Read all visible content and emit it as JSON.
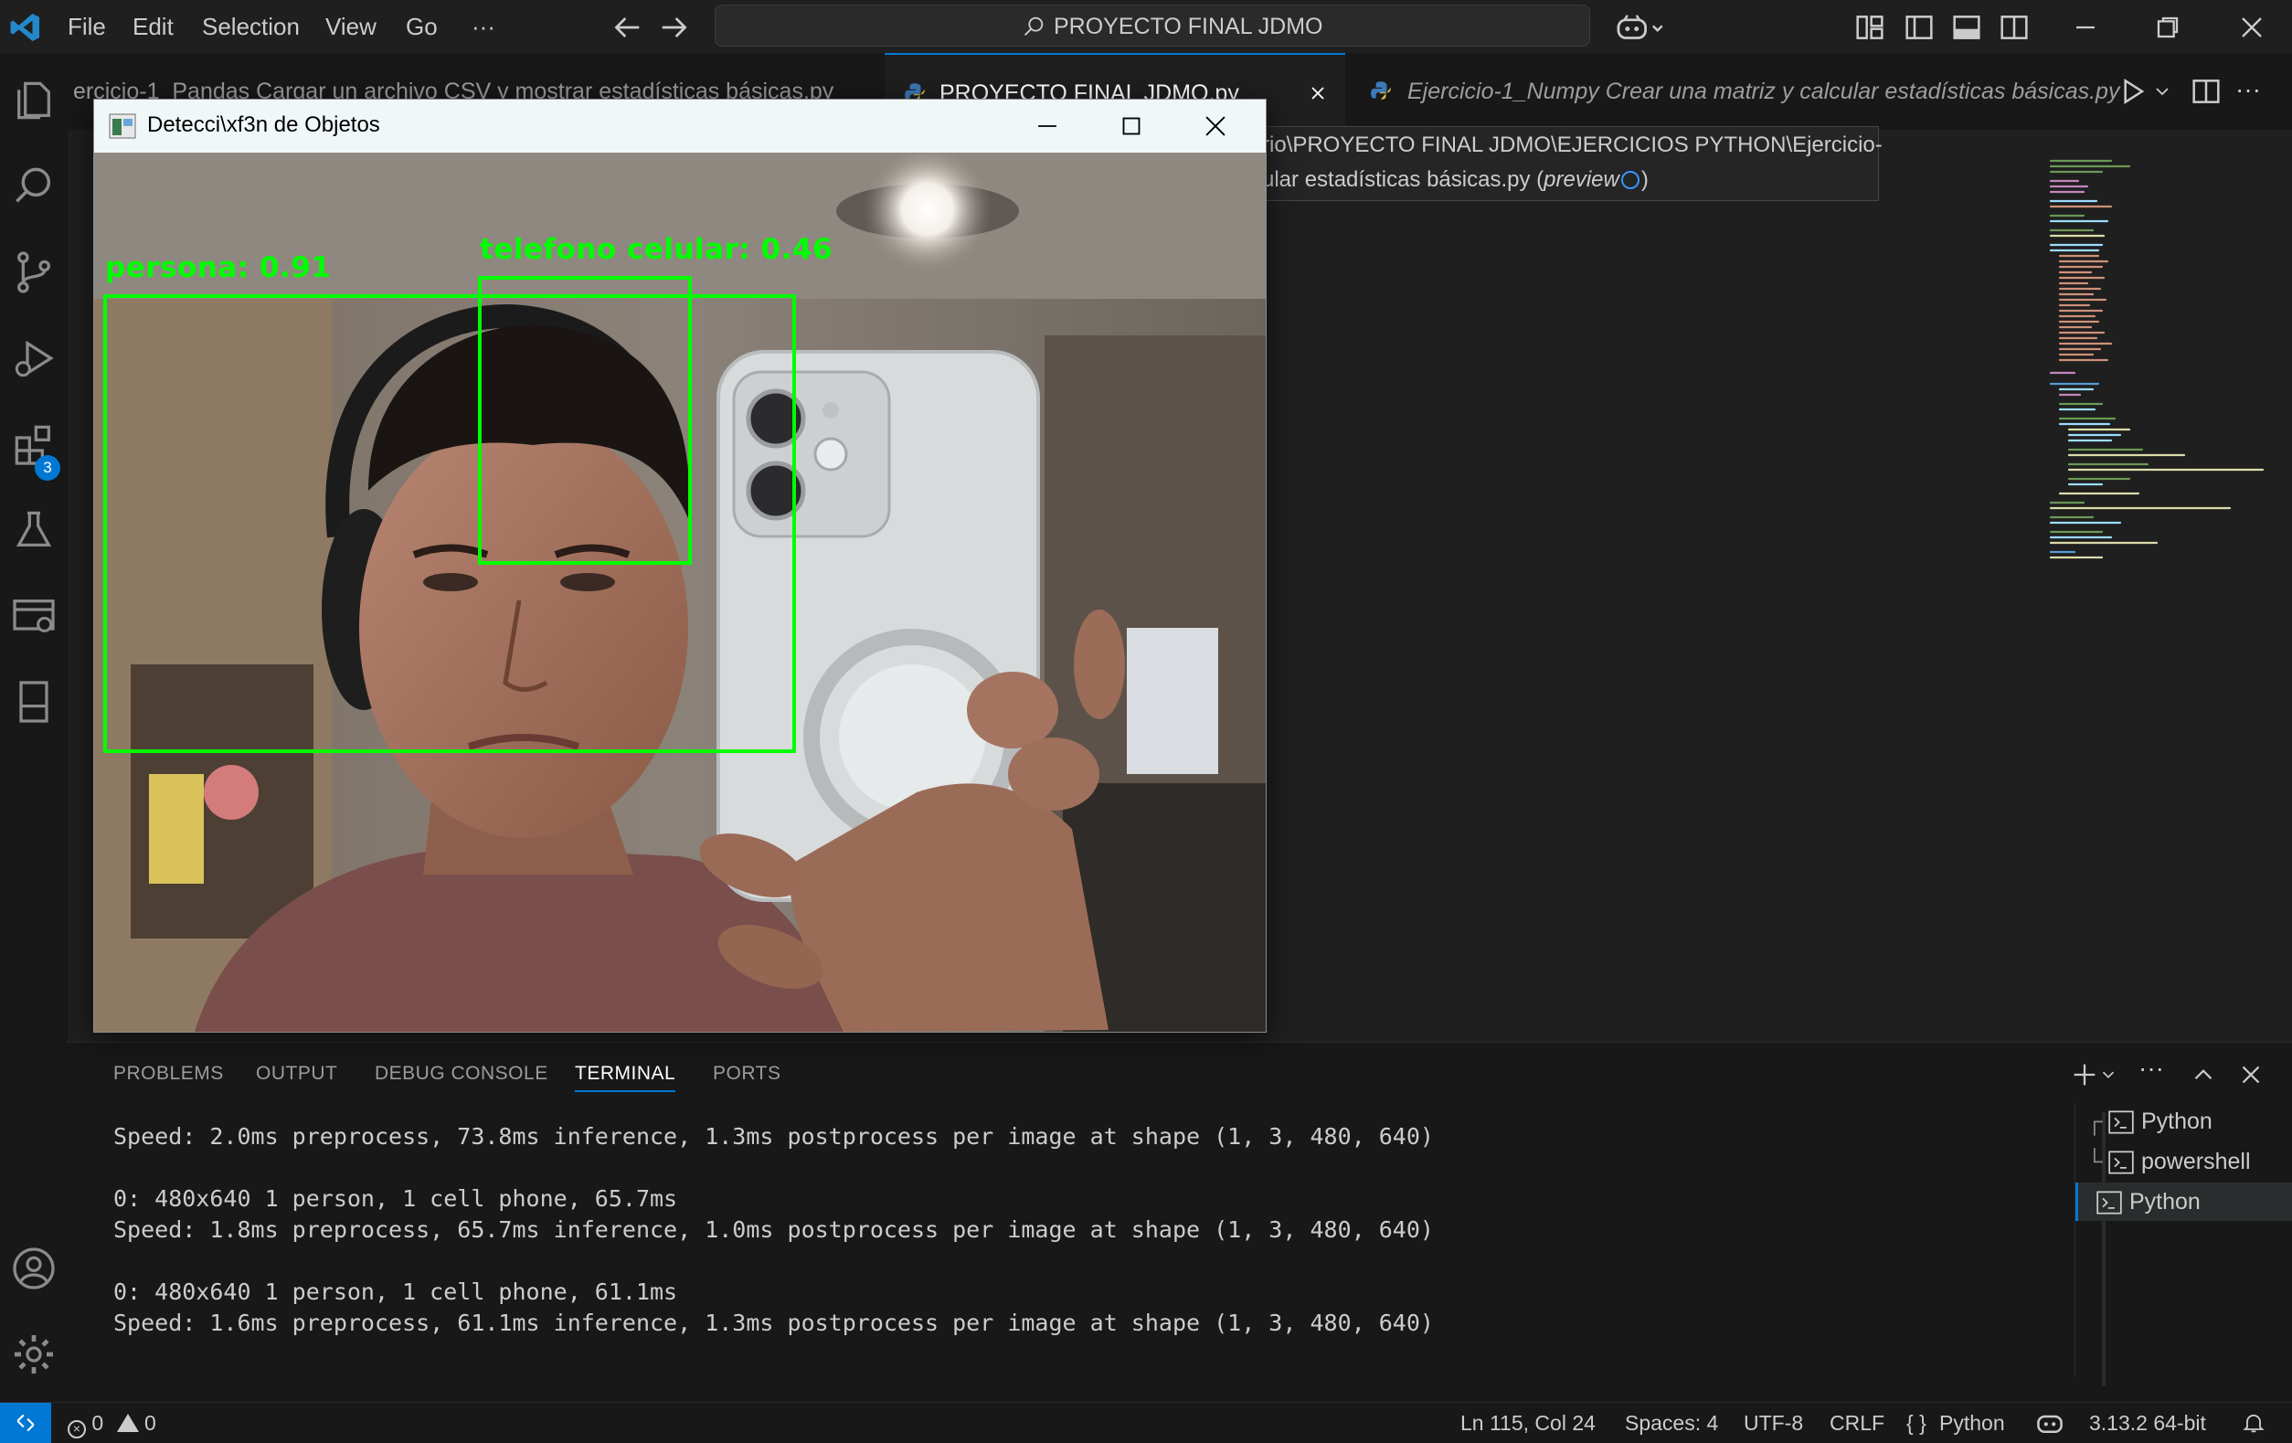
{
  "menu": {
    "items": [
      "File",
      "Edit",
      "Selection",
      "View",
      "Go",
      "···"
    ],
    "search_text": "PROYECTO FINAL JDMO"
  },
  "activity": {
    "extensions_badge": "3"
  },
  "tabs": [
    {
      "label": "ercicio-1_Pandas Cargar un archivo CSV y mostrar estadísticas básicas.py",
      "active": false
    },
    {
      "label": "PROYECTO FINAL JDMO.py",
      "active": true
    },
    {
      "label": "Ejercicio-1_Numpy Crear una matriz y calcular estadísticas básicas.py",
      "active": false,
      "preview": true
    }
  ],
  "tooltip": {
    "line1": "rio\\PROYECTO FINAL JDMO\\EJERCICIOS PYTHON\\Ejercicio-",
    "line2": "ular estadísticas básicas.py (",
    "line2_em": "preview",
    "line2_end": ")"
  },
  "panel": {
    "tabs": [
      "PROBLEMS",
      "OUTPUT",
      "DEBUG CONSOLE",
      "TERMINAL",
      "PORTS"
    ],
    "active_tab": "TERMINAL",
    "terminal_lines": [
      "Speed: 2.0ms preprocess, 73.8ms inference, 1.3ms postprocess per image at shape (1, 3, 480, 640)",
      "",
      "0: 480x640 1 person, 1 cell phone, 65.7ms",
      "Speed: 1.8ms preprocess, 65.7ms inference, 1.0ms postprocess per image at shape (1, 3, 480, 640)",
      "",
      "0: 480x640 1 person, 1 cell phone, 61.1ms",
      "Speed: 1.6ms preprocess, 61.1ms inference, 1.3ms postprocess per image at shape (1, 3, 480, 640)"
    ],
    "terminals": [
      {
        "prefix": "┌",
        "label": "Python"
      },
      {
        "prefix": "└",
        "label": "powershell"
      },
      {
        "prefix": "",
        "label": "Python",
        "selected": true
      }
    ]
  },
  "status": {
    "errors": "0",
    "warnings": "0",
    "position": "Ln 115, Col 24",
    "spaces": "Spaces: 4",
    "encoding": "UTF-8",
    "eol": "CRLF",
    "language_icon": "{ }",
    "language": "Python",
    "interpreter": "3.13.2 64-bit"
  },
  "detection_window": {
    "title": "Detecci\\xf3n de Objetos",
    "detections": [
      {
        "label": "persona: 0.91"
      },
      {
        "label": "telefono celular: 0.46"
      }
    ]
  },
  "colors": {
    "accent": "#0078d4",
    "detect": "#00ff00",
    "status_remote": "#0078d4"
  }
}
